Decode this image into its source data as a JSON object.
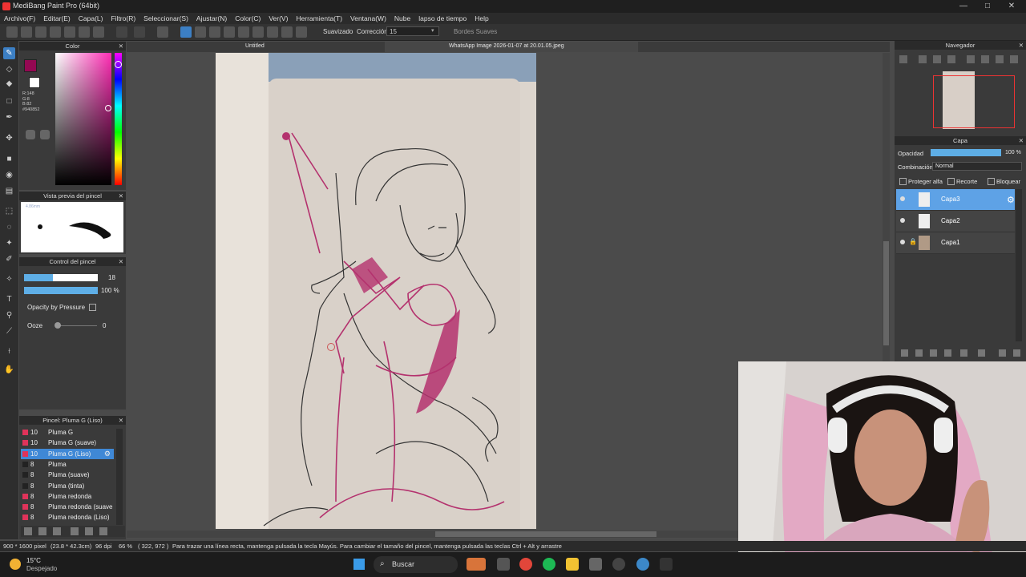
{
  "app": {
    "title": "MediBang Paint Pro (64bit)",
    "window_controls": [
      "—",
      "□",
      "✕"
    ]
  },
  "menu": [
    "Archivo(F)",
    "Editar(E)",
    "Capa(L)",
    "Filtro(R)",
    "Seleccionar(S)",
    "Ajustar(N)",
    "Color(C)",
    "Ver(V)",
    "Herramienta(T)",
    "Ventana(W)",
    "Nube",
    "lapso de tiempo",
    "Help"
  ],
  "toolbar": {
    "suavizado_label": "Suavizado",
    "correccion_label": "Corrección",
    "correccion_value": "15",
    "bordes_label": "Bordes Suaves"
  },
  "color_panel": {
    "title": "Color",
    "readout": [
      "R:148",
      "G:8",
      "B:82",
      "#940852"
    ],
    "primary_color": "#940852",
    "accent": "#d6066f"
  },
  "brush_preview": {
    "title": "Vista previa del pincel",
    "size_text": "4.86mm"
  },
  "brush_control": {
    "title": "Control del pincel",
    "size_value": "18",
    "opacity_value": "100 %",
    "opacity_pressure_label": "Opacity by Pressure",
    "ooze_label": "Ooze",
    "ooze_value": "0"
  },
  "brush_list": {
    "title": "Pincel: Pluma G (Liso)",
    "items": [
      {
        "size": "10",
        "name": "Pluma G",
        "color": "#e0335a"
      },
      {
        "size": "10",
        "name": "Pluma G (suave)",
        "color": "#e0335a"
      },
      {
        "size": "10",
        "name": "Pluma G (Liso)",
        "color": "#e0335a"
      },
      {
        "size": "8",
        "name": "Pluma",
        "color": "#222222"
      },
      {
        "size": "8",
        "name": "Pluma (suave)",
        "color": "#222222"
      },
      {
        "size": "8",
        "name": "Pluma (tinta)",
        "color": "#222222"
      },
      {
        "size": "8",
        "name": "Pluma redonda",
        "color": "#e0335a"
      },
      {
        "size": "8",
        "name": "Pluma redonda (suave",
        "color": "#e0335a"
      },
      {
        "size": "8",
        "name": "Pluma redonda (Liso)",
        "color": "#e0335a"
      }
    ],
    "selected_index": 2
  },
  "tabs": {
    "left": "Untitled",
    "right": "WhatsApp Image 2026-01-07 at 20.01.05.jpeg"
  },
  "navigator": {
    "title": "Navegador"
  },
  "layer_panel": {
    "title": "Capa",
    "opacity_label": "Opacidad",
    "opacity_value": "100 %",
    "blend_label": "Combinación",
    "blend_value": "Normal",
    "protect_alpha": "Proteger alfa",
    "clip": "Recorte",
    "lock": "Bloquear",
    "layers": [
      {
        "name": "Capa3",
        "selected": true
      },
      {
        "name": "Capa2",
        "selected": false
      },
      {
        "name": "Capa1",
        "selected": false
      }
    ]
  },
  "status": {
    "dims": "900 * 1600 pixel",
    "size": "(23.8 * 42.3cm)",
    "dpi": "96 dpi",
    "zoom": "66 %",
    "coords": "( 322, 972 )",
    "hint": "Para trazar una línea recta, mantenga pulsada la tecla Mayús. Para cambiar el tamaño del pincel, mantenga pulsada las teclas Ctrl + Alt y arrastre"
  },
  "taskbar": {
    "temp": "15°C",
    "weather": "Despejado",
    "search": "Buscar"
  }
}
